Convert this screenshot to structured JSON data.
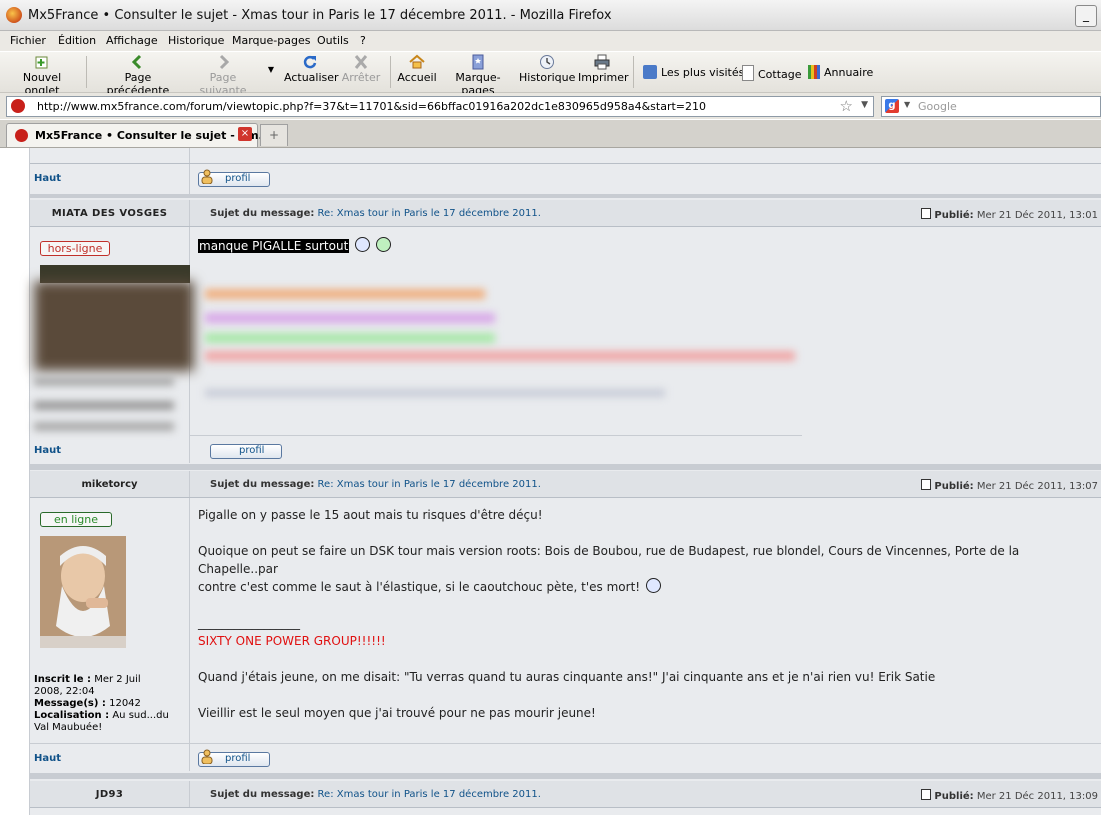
{
  "window": {
    "title": "Mx5France • Consulter le sujet - Xmas tour in Paris le 17 décembre 2011. - Mozilla Firefox",
    "minimize_glyph": "_"
  },
  "menu": [
    "Fichier",
    "Édition",
    "Affichage",
    "Historique",
    "Marque-pages",
    "Outils",
    "?"
  ],
  "toolbar": {
    "new_tab": "Nouvel onglet",
    "back": "Page précédente",
    "forward": "Page suivante",
    "reload": "Actualiser",
    "stop": "Arrêter",
    "home": "Accueil",
    "bookmarks": "Marque-pages",
    "history": "Historique",
    "print": "Imprimer"
  },
  "bookmarks_bar": [
    "Les plus visités",
    "Cottage",
    "Annuaire"
  ],
  "url": {
    "value": "http://www.mx5france.com/forum/viewtopic.php?f=37&t=11701&sid=66bffac01916a202dc1e830965d958a4&start=210",
    "star": "☆",
    "dropdown": "▼"
  },
  "search": {
    "placeholder": "Google",
    "engine_icon": "g"
  },
  "tab": {
    "label": "Mx5France • Consulter le sujet - Xm...",
    "close": "×",
    "new": "+"
  },
  "common": {
    "haut": "Haut",
    "profil": "profil",
    "subject_label": "Sujet du message:",
    "subject": "Re: Xmas tour in Paris le 17 décembre 2011.",
    "published_label": "Publié:"
  },
  "posts": [
    {
      "author": "MIATA DES VOSGES",
      "date": "Mer 21 Déc 2011, 13:01",
      "status": "hors-ligne",
      "status_color": "#c0302a",
      "message": "manque PIGALLE surtout"
    },
    {
      "author": "miketorcy",
      "date": "Mer 21 Déc 2011, 13:07",
      "status": "en ligne",
      "status_color": "#2a8a2a",
      "lines": [
        "Pigalle on y passe le 15 aout mais tu risques d'être déçu!",
        "Quoique on peut se faire un DSK tour mais version roots: Bois de Boubou, rue de Budapest, rue blondel, Cours de Vincennes, Porte de la Chapelle..par",
        "contre c'est comme le saut à l'élastique, si le caoutchouc pète, t'es mort!",
        "_________________",
        "SIXTY ONE POWER GROUP!!!!!!",
        "Quand j'étais jeune, on me disait: \"Tu verras quand tu auras cinquante ans!\" J'ai cinquante ans et je n'ai rien vu! Erik Satie",
        "Vieillir est le seul moyen que j'ai trouvé pour ne pas mourir jeune!"
      ],
      "info": {
        "inscrit_label": "Inscrit le :",
        "inscrit_l1": "Mer 2 Juil",
        "inscrit_l2": "2008, 22:04",
        "messages_label": "Message(s) :",
        "messages": "12042",
        "loc_label": "Localisation :",
        "loc_l1": "Au sud...du",
        "loc_l2": "Val Maubuée!"
      }
    },
    {
      "author": "JD93",
      "date": "Mer 21 Déc 2011, 13:09"
    }
  ]
}
